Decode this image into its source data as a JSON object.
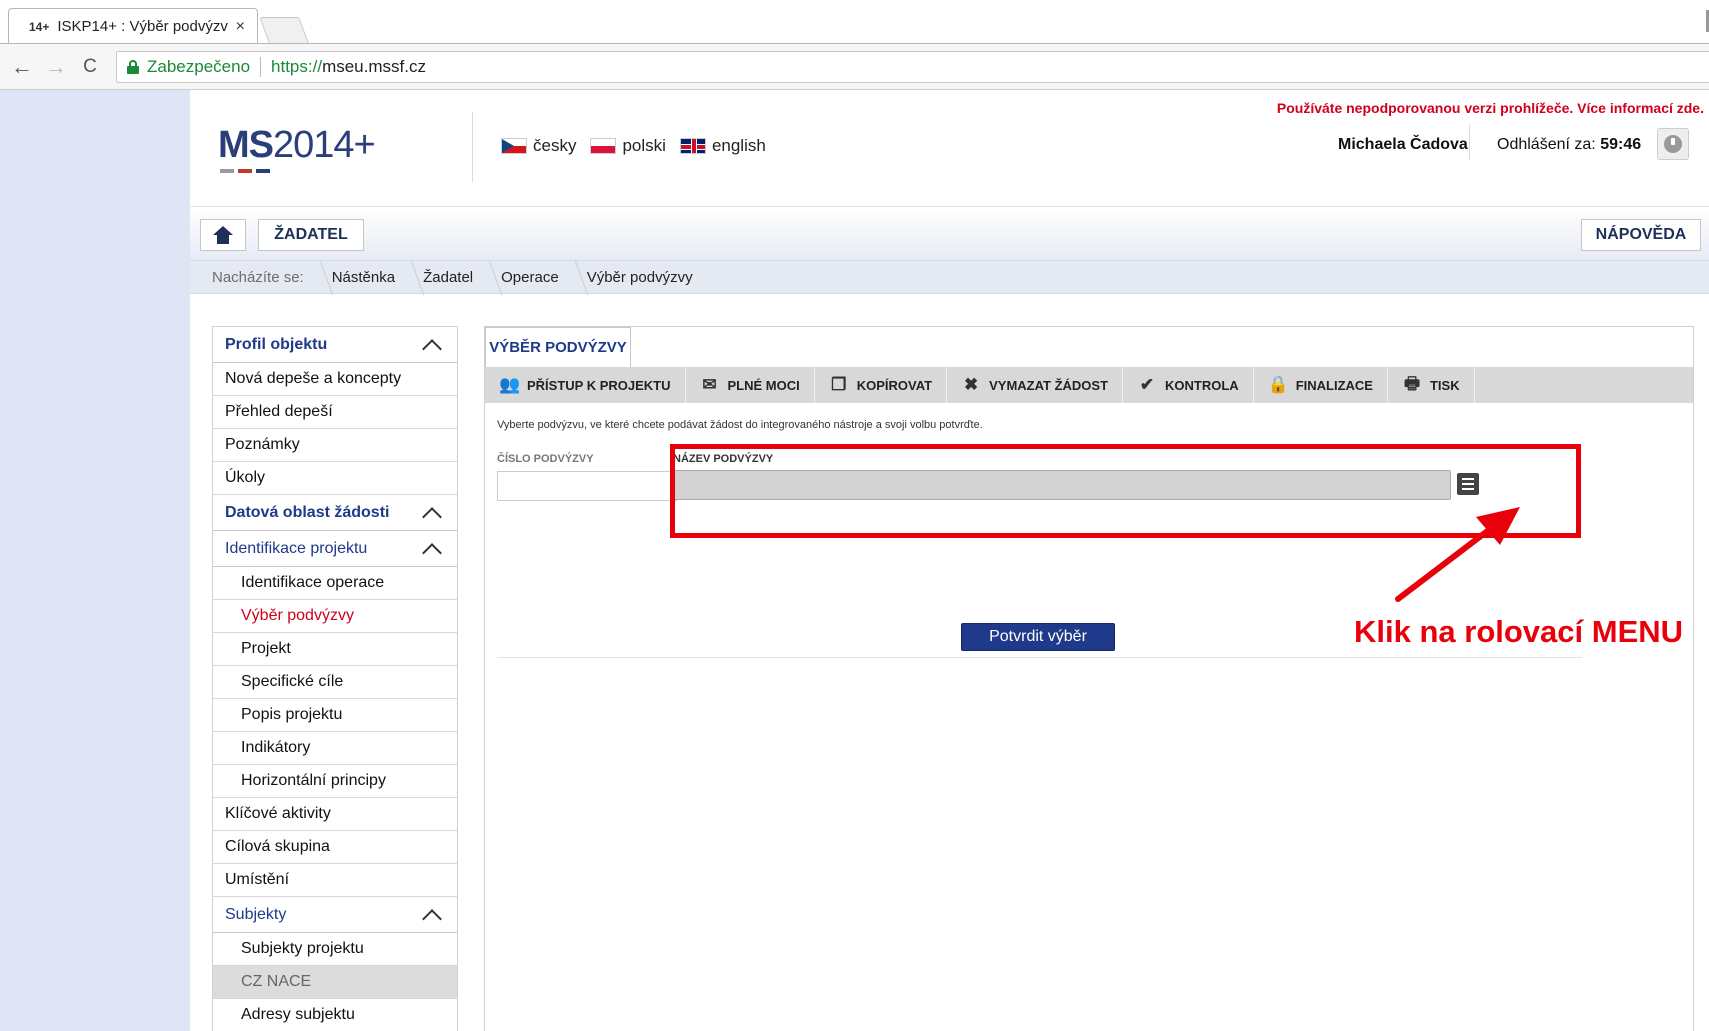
{
  "browser": {
    "tab_favicon": "14+",
    "tab_title": "ISKP14+ : Výběr podvýzv",
    "tab_close": "×",
    "back": "←",
    "forward": "→",
    "reload": "C",
    "secure_label": "Zabezpečeno",
    "url_proto": "https://",
    "url_host": "mseu.mssf.cz"
  },
  "header": {
    "warning": "Používáte nepodporovanou verzi prohlížeče. Více informací zde.",
    "logo_ms": "MS",
    "logo_rest": "2014+",
    "logo_colors": [
      "#9a9a9a",
      "#c0392b",
      "#2a3f7a"
    ],
    "languages": [
      {
        "label": "česky",
        "flag": "cz-flag-icon"
      },
      {
        "label": "polski",
        "flag": "pl-flag-icon"
      },
      {
        "label": "english",
        "flag": "uk-flag-icon"
      }
    ],
    "user_name": "Michaela Čadova",
    "logout_label": "Odhlášení za:",
    "logout_time": "59:46"
  },
  "topnav": {
    "role": "ŽADATEL",
    "help": "NÁPOVĚDA"
  },
  "breadcrumb": {
    "label": "Nacházíte se:",
    "items": [
      "Nástěnka",
      "Žadatel",
      "Operace",
      "Výběr podvýzvy"
    ]
  },
  "sidebar": {
    "items": [
      {
        "label": "Profil objektu",
        "type": "section bold"
      },
      {
        "label": "Nová depeše a koncepty",
        "type": "item"
      },
      {
        "label": "Přehled depeší",
        "type": "item"
      },
      {
        "label": "Poznámky",
        "type": "item"
      },
      {
        "label": "Úkoly",
        "type": "item"
      },
      {
        "label": "Datová oblast žádosti",
        "type": "section bold"
      },
      {
        "label": "Identifikace projektu",
        "type": "section"
      },
      {
        "label": "Identifikace operace",
        "type": "sub"
      },
      {
        "label": "Výběr podvýzvy",
        "type": "sub active"
      },
      {
        "label": "Projekt",
        "type": "sub"
      },
      {
        "label": "Specifické cíle",
        "type": "sub"
      },
      {
        "label": "Popis projektu",
        "type": "sub"
      },
      {
        "label": "Indikátory",
        "type": "sub"
      },
      {
        "label": "Horizontální principy",
        "type": "sub"
      },
      {
        "label": "Klíčové aktivity",
        "type": "item"
      },
      {
        "label": "Cílová skupina",
        "type": "item"
      },
      {
        "label": "Umístění",
        "type": "item"
      },
      {
        "label": "Subjekty",
        "type": "section"
      },
      {
        "label": "Subjekty projektu",
        "type": "sub"
      },
      {
        "label": "CZ NACE",
        "type": "sub grey"
      },
      {
        "label": "Adresy subjektu",
        "type": "sub"
      }
    ]
  },
  "main": {
    "tab_title": "VÝBĚR PODVÝZVY",
    "toolbar": [
      {
        "label": "PŘÍSTUP K PROJEKTU",
        "icon": "people-icon",
        "glyph": "👥"
      },
      {
        "label": "PLNÉ MOCI",
        "icon": "envelope-icon",
        "glyph": "✉"
      },
      {
        "label": "KOPÍROVAT",
        "icon": "copy-icon",
        "glyph": "❐"
      },
      {
        "label": "VYMAZAT ŽÁDOST",
        "icon": "delete-icon",
        "glyph": "✖"
      },
      {
        "label": "KONTROLA",
        "icon": "check-icon",
        "glyph": "✔"
      },
      {
        "label": "FINALIZACE",
        "icon": "lock-icon",
        "glyph": "🔒"
      },
      {
        "label": "TISK",
        "icon": "print-icon",
        "glyph": "🖶"
      }
    ],
    "instruction": "Vyberte podvýzvu, ve které chcete podávat žádost do integrovaného nástroje a svoji volbu potvrďte.",
    "cislo_label": "ČÍSLO PODVÝZVY",
    "cislo_value": "",
    "nazev_label": "NÁZEV PODVÝZVY",
    "nazev_value": "",
    "confirm": "Potvrdit výběr"
  },
  "annotation": {
    "text": "Klik na rolovací MENU",
    "color": "#e8000b"
  }
}
